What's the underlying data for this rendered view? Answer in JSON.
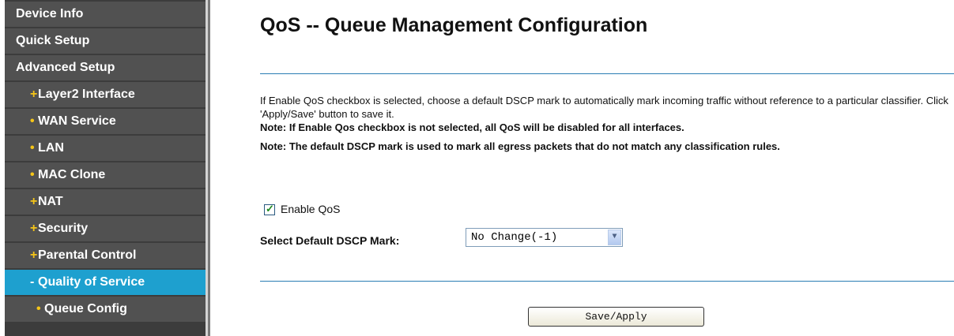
{
  "sidebar": {
    "items": [
      {
        "label": "Device Info",
        "bullet": ""
      },
      {
        "label": "Quick Setup",
        "bullet": ""
      },
      {
        "label": "Advanced Setup",
        "bullet": ""
      },
      {
        "label": "Layer2 Interface",
        "bullet": "+"
      },
      {
        "label": "WAN Service",
        "bullet": "•"
      },
      {
        "label": "LAN",
        "bullet": "•"
      },
      {
        "label": "MAC Clone",
        "bullet": "•"
      },
      {
        "label": "NAT",
        "bullet": "+"
      },
      {
        "label": "Security",
        "bullet": "+"
      },
      {
        "label": "Parental Control",
        "bullet": "+"
      },
      {
        "label": "Quality of Service",
        "bullet": "-"
      },
      {
        "label": "Queue Config",
        "bullet": "•"
      }
    ],
    "active_item": "Quality of Service"
  },
  "main": {
    "title": "QoS -- Queue Management Configuration",
    "description": "If Enable QoS checkbox is selected, choose a default DSCP mark to automatically mark incoming traffic without reference to a particular classifier. Click 'Apply/Save' button to save it.",
    "note1": "Note: If Enable Qos checkbox is not selected, all QoS will be disabled for all interfaces.",
    "note2": "Note: The default DSCP mark is used to mark all egress packets that do not match any classification rules.",
    "enable_qos": {
      "label": "Enable QoS",
      "checked": true
    },
    "dscp": {
      "label": "Select Default DSCP Mark:",
      "selected": "No Change(-1)"
    },
    "save_button": "Save/Apply"
  },
  "colors": {
    "sidebar_bg": "#515151",
    "sidebar_active": "#1ea0cf",
    "bullet": "#f5c518",
    "rule": "#2a7db3"
  }
}
